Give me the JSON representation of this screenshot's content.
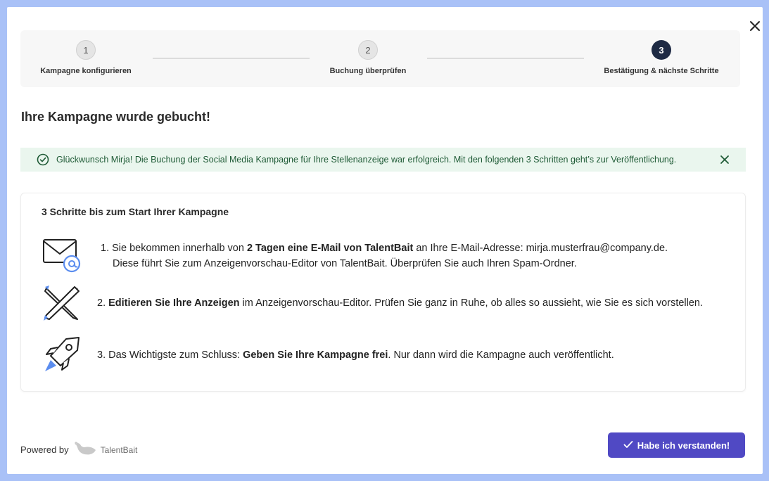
{
  "modal": {
    "close_icon": "close-icon"
  },
  "stepper": {
    "steps": [
      {
        "number": "1",
        "label": "Kampagne konfigurieren",
        "state": "done"
      },
      {
        "number": "2",
        "label": "Buchung überprüfen",
        "state": "done"
      },
      {
        "number": "3",
        "label": "Bestätigung & nächste Schritte",
        "state": "active"
      }
    ]
  },
  "title": "Ihre Kampagne wurde gebucht!",
  "banner": {
    "icon": "check-circle-icon",
    "message": "Glückwunsch Mirja! Die Buchung der Social Media Kampagne für Ihre Stellenanzeige war erfolgreich. Mit den folgenden 3 Schritten geht’s zur Veröffentlichung.",
    "close_icon": "close-icon"
  },
  "steps_card": {
    "title": "3 Schritte bis zum Start Ihrer Kampagne",
    "items": [
      {
        "icon": "email-icon",
        "prefix": "1. Sie bekommen innerhalb von ",
        "bold": "2 Tagen eine E-Mail von TalentBait",
        "suffix": " an Ihre E-Mail-Adresse: mirja.musterfrau@company.de.",
        "line2": "Diese führt Sie zum Anzeigenvorschau-Editor von TalentBait. Überprüfen Sie auch Ihren Spam-Ordner."
      },
      {
        "icon": "edit-tools-icon",
        "prefix": "2. ",
        "bold": "Editieren Sie Ihre Anzeigen",
        "suffix": " im Anzeigenvorschau-Editor. Prüfen Sie ganz in Ruhe, ob alles so aussieht, wie Sie es sich vorstellen."
      },
      {
        "icon": "rocket-icon",
        "prefix": "3. Das Wichtigste zum Schluss: ",
        "bold": "Geben Sie Ihre Kampagne frei",
        "suffix": ". Nur dann wird die Kampagne auch veröffentlicht."
      }
    ]
  },
  "footer": {
    "powered_by": "Powered by",
    "brand": "TalentBait",
    "confirm_button": "Habe ich verstanden!"
  },
  "colors": {
    "backdrop": "#a9c1f7",
    "primary_button": "#5049c4",
    "active_step": "#1e2a44",
    "success_bg": "#eaf6ee",
    "success_text": "#1f5b36"
  }
}
